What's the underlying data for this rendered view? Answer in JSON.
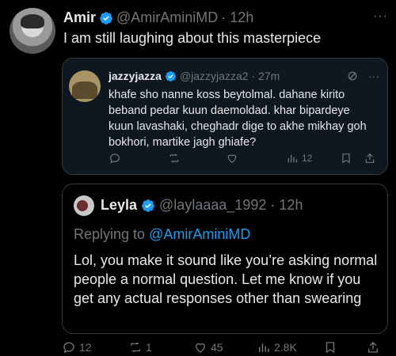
{
  "main_tweet": {
    "name": "Amir",
    "handle": "@AmirAminiMD",
    "time": "· 12h",
    "text": "I am still laughing about this masterpiece",
    "more": "···"
  },
  "quote1": {
    "name": "jazzyjazza",
    "handle": "@jazzyjazza2",
    "time": "· 27m",
    "more": "···",
    "text": "khafe sho nanne koss beytolmal. dahane kirito beband pedar kuun daemoldad. khar bipardeye kuun lavashaki, cheghadr dige to akhe mikhay goh bokhori, martike jagh ghiafe?",
    "views": "12"
  },
  "quote2": {
    "name": "Leyla",
    "handle": "@laylaaaa_1992",
    "time": "· 12h",
    "replying_label": "Replying to",
    "replying_handle": "@AmirAminiMD",
    "text": "Lol, you make it sound like you’re asking normal people a normal question. Let me know if you get any actual responses other than swearing"
  },
  "bottom_actions": {
    "replies": "12",
    "retweets": "1",
    "likes": "45",
    "views": "2.8K"
  },
  "colors": {
    "background": "#000000",
    "quote_bg": "#0f1720",
    "accent": "#1d9bf0",
    "muted": "#71767b"
  }
}
